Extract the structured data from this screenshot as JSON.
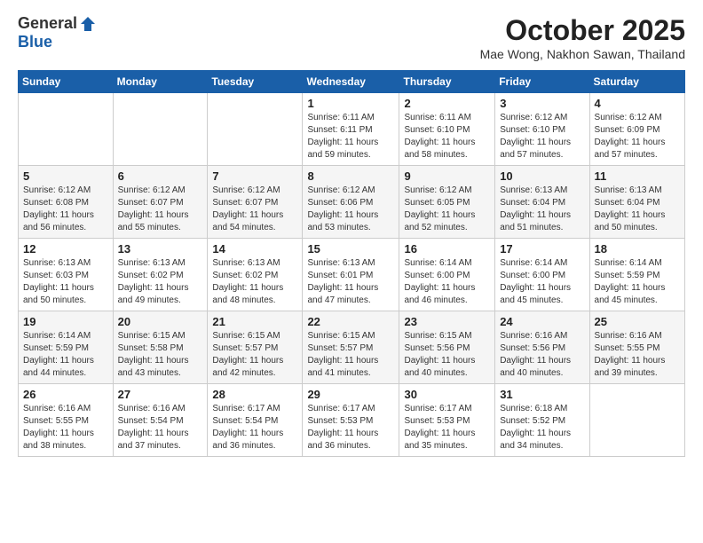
{
  "header": {
    "logo_general": "General",
    "logo_blue": "Blue",
    "month_title": "October 2025",
    "location": "Mae Wong, Nakhon Sawan, Thailand"
  },
  "days_of_week": [
    "Sunday",
    "Monday",
    "Tuesday",
    "Wednesday",
    "Thursday",
    "Friday",
    "Saturday"
  ],
  "weeks": [
    [
      {
        "day": "",
        "info": ""
      },
      {
        "day": "",
        "info": ""
      },
      {
        "day": "",
        "info": ""
      },
      {
        "day": "1",
        "info": "Sunrise: 6:11 AM\nSunset: 6:11 PM\nDaylight: 11 hours\nand 59 minutes."
      },
      {
        "day": "2",
        "info": "Sunrise: 6:11 AM\nSunset: 6:10 PM\nDaylight: 11 hours\nand 58 minutes."
      },
      {
        "day": "3",
        "info": "Sunrise: 6:12 AM\nSunset: 6:10 PM\nDaylight: 11 hours\nand 57 minutes."
      },
      {
        "day": "4",
        "info": "Sunrise: 6:12 AM\nSunset: 6:09 PM\nDaylight: 11 hours\nand 57 minutes."
      }
    ],
    [
      {
        "day": "5",
        "info": "Sunrise: 6:12 AM\nSunset: 6:08 PM\nDaylight: 11 hours\nand 56 minutes."
      },
      {
        "day": "6",
        "info": "Sunrise: 6:12 AM\nSunset: 6:07 PM\nDaylight: 11 hours\nand 55 minutes."
      },
      {
        "day": "7",
        "info": "Sunrise: 6:12 AM\nSunset: 6:07 PM\nDaylight: 11 hours\nand 54 minutes."
      },
      {
        "day": "8",
        "info": "Sunrise: 6:12 AM\nSunset: 6:06 PM\nDaylight: 11 hours\nand 53 minutes."
      },
      {
        "day": "9",
        "info": "Sunrise: 6:12 AM\nSunset: 6:05 PM\nDaylight: 11 hours\nand 52 minutes."
      },
      {
        "day": "10",
        "info": "Sunrise: 6:13 AM\nSunset: 6:04 PM\nDaylight: 11 hours\nand 51 minutes."
      },
      {
        "day": "11",
        "info": "Sunrise: 6:13 AM\nSunset: 6:04 PM\nDaylight: 11 hours\nand 50 minutes."
      }
    ],
    [
      {
        "day": "12",
        "info": "Sunrise: 6:13 AM\nSunset: 6:03 PM\nDaylight: 11 hours\nand 50 minutes."
      },
      {
        "day": "13",
        "info": "Sunrise: 6:13 AM\nSunset: 6:02 PM\nDaylight: 11 hours\nand 49 minutes."
      },
      {
        "day": "14",
        "info": "Sunrise: 6:13 AM\nSunset: 6:02 PM\nDaylight: 11 hours\nand 48 minutes."
      },
      {
        "day": "15",
        "info": "Sunrise: 6:13 AM\nSunset: 6:01 PM\nDaylight: 11 hours\nand 47 minutes."
      },
      {
        "day": "16",
        "info": "Sunrise: 6:14 AM\nSunset: 6:00 PM\nDaylight: 11 hours\nand 46 minutes."
      },
      {
        "day": "17",
        "info": "Sunrise: 6:14 AM\nSunset: 6:00 PM\nDaylight: 11 hours\nand 45 minutes."
      },
      {
        "day": "18",
        "info": "Sunrise: 6:14 AM\nSunset: 5:59 PM\nDaylight: 11 hours\nand 45 minutes."
      }
    ],
    [
      {
        "day": "19",
        "info": "Sunrise: 6:14 AM\nSunset: 5:59 PM\nDaylight: 11 hours\nand 44 minutes."
      },
      {
        "day": "20",
        "info": "Sunrise: 6:15 AM\nSunset: 5:58 PM\nDaylight: 11 hours\nand 43 minutes."
      },
      {
        "day": "21",
        "info": "Sunrise: 6:15 AM\nSunset: 5:57 PM\nDaylight: 11 hours\nand 42 minutes."
      },
      {
        "day": "22",
        "info": "Sunrise: 6:15 AM\nSunset: 5:57 PM\nDaylight: 11 hours\nand 41 minutes."
      },
      {
        "day": "23",
        "info": "Sunrise: 6:15 AM\nSunset: 5:56 PM\nDaylight: 11 hours\nand 40 minutes."
      },
      {
        "day": "24",
        "info": "Sunrise: 6:16 AM\nSunset: 5:56 PM\nDaylight: 11 hours\nand 40 minutes."
      },
      {
        "day": "25",
        "info": "Sunrise: 6:16 AM\nSunset: 5:55 PM\nDaylight: 11 hours\nand 39 minutes."
      }
    ],
    [
      {
        "day": "26",
        "info": "Sunrise: 6:16 AM\nSunset: 5:55 PM\nDaylight: 11 hours\nand 38 minutes."
      },
      {
        "day": "27",
        "info": "Sunrise: 6:16 AM\nSunset: 5:54 PM\nDaylight: 11 hours\nand 37 minutes."
      },
      {
        "day": "28",
        "info": "Sunrise: 6:17 AM\nSunset: 5:54 PM\nDaylight: 11 hours\nand 36 minutes."
      },
      {
        "day": "29",
        "info": "Sunrise: 6:17 AM\nSunset: 5:53 PM\nDaylight: 11 hours\nand 36 minutes."
      },
      {
        "day": "30",
        "info": "Sunrise: 6:17 AM\nSunset: 5:53 PM\nDaylight: 11 hours\nand 35 minutes."
      },
      {
        "day": "31",
        "info": "Sunrise: 6:18 AM\nSunset: 5:52 PM\nDaylight: 11 hours\nand 34 minutes."
      },
      {
        "day": "",
        "info": ""
      }
    ]
  ]
}
